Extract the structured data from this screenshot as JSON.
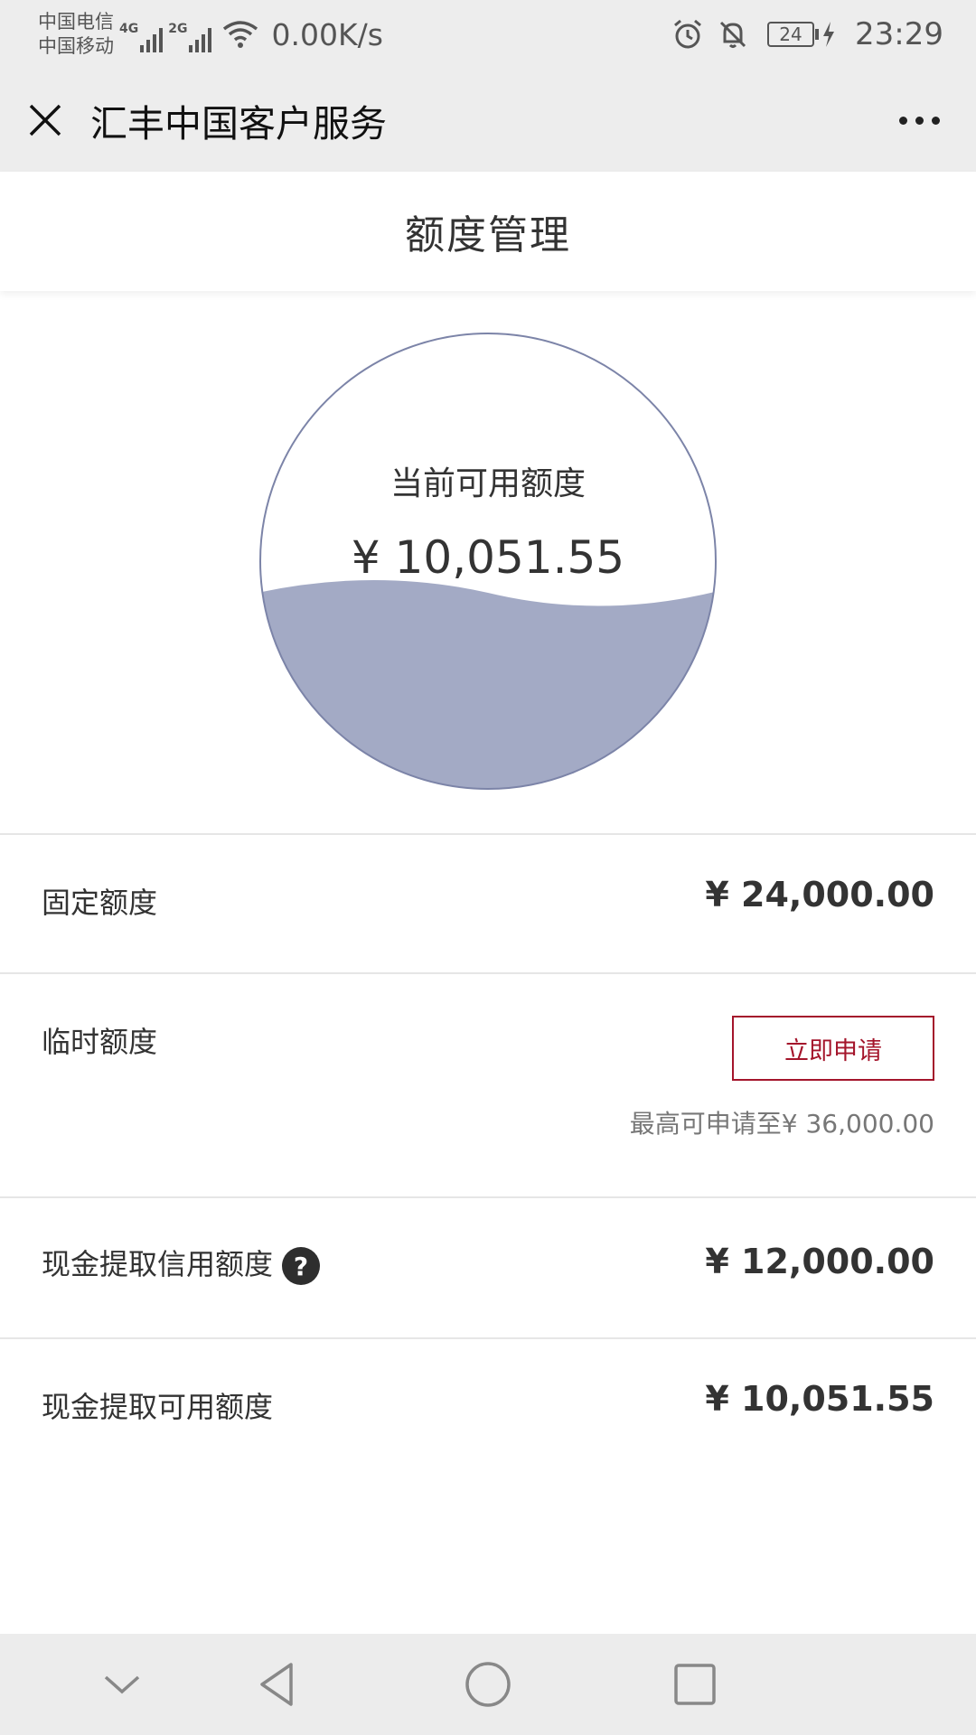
{
  "status_bar": {
    "carrier1": "中国电信",
    "carrier2": "中国移动",
    "network1": "4G",
    "network2": "2G",
    "speed": "0.00K/s",
    "battery": "24",
    "time": "23:29"
  },
  "header": {
    "title": "汇丰中国客户服务",
    "close_icon": "close-icon",
    "more_icon": "more-icon"
  },
  "page": {
    "title": "额度管理"
  },
  "gauge": {
    "label": "当前可用额度",
    "amount": "¥ 10,051.55",
    "fill_color": "#a3aac5",
    "outline_color": "#7c84a8"
  },
  "rows": {
    "fixed": {
      "label": "固定额度",
      "value": "¥ 24,000.00"
    },
    "temp": {
      "label": "临时额度",
      "button": "立即申请",
      "hint": "最高可申请至¥ 36,000.00"
    },
    "cash_credit": {
      "label": "现金提取信用额度",
      "help": "?",
      "value": "¥ 12,000.00"
    },
    "cash_available": {
      "label": "现金提取可用额度",
      "value": "¥ 10,051.55"
    }
  },
  "accent_color": "#a4152b",
  "nav": {
    "icons": [
      "chevron-down-icon",
      "back-icon",
      "home-icon",
      "recents-icon"
    ]
  }
}
